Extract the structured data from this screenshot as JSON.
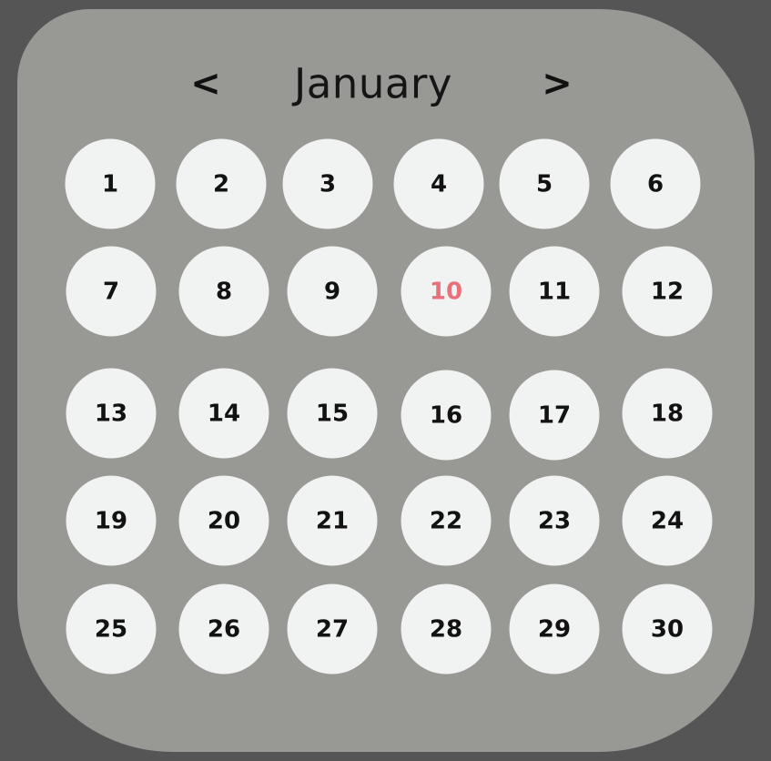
{
  "calendar": {
    "month": "January",
    "prev_label": "<",
    "next_label": ">",
    "today_color": "#e9707a",
    "days": [
      "1",
      "2",
      "3",
      "4",
      "5",
      "6",
      "7",
      "8",
      "9",
      "10",
      "11",
      "12",
      "13",
      "14",
      "15",
      "16",
      "17",
      "18",
      "19",
      "20",
      "21",
      "22",
      "23",
      "24",
      "25",
      "26",
      "27",
      "28",
      "29",
      "30"
    ],
    "highlighted_day": "10"
  }
}
